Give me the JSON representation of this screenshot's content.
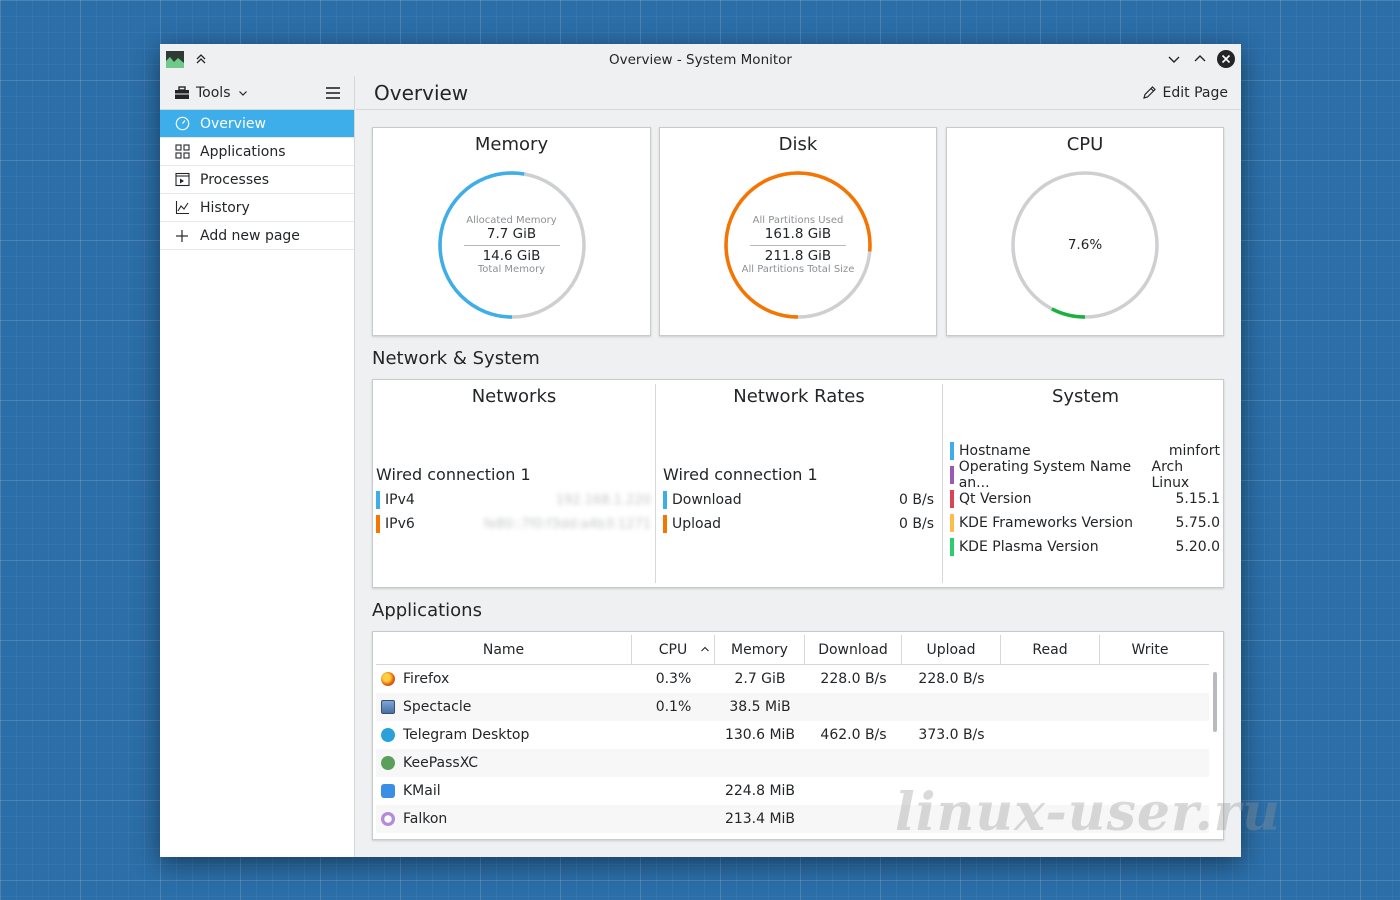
{
  "window": {
    "title": "Overview - System Monitor"
  },
  "sidebar": {
    "tools_label": "Tools",
    "items": [
      {
        "label": "Overview",
        "icon": "speedometer-icon",
        "active": true
      },
      {
        "label": "Applications",
        "icon": "grid-icon"
      },
      {
        "label": "Processes",
        "icon": "terminal-window-icon"
      },
      {
        "label": "History",
        "icon": "line-chart-icon"
      },
      {
        "label": "Add new page",
        "icon": "plus-icon"
      }
    ]
  },
  "header": {
    "title": "Overview",
    "edit_label": "Edit Page"
  },
  "gauges": {
    "memory": {
      "title": "Memory",
      "top_label": "Allocated Memory",
      "used": "7.7 GiB",
      "total": "14.6 GiB",
      "bottom_label": "Total Memory",
      "fraction": 0.527,
      "color": "#3daee9"
    },
    "disk": {
      "title": "Disk",
      "top_label": "All Partitions Used",
      "used": "161.8 GiB",
      "total": "211.8 GiB",
      "bottom_label": "All Partitions Total Size",
      "fraction": 0.764,
      "color": "#f67400"
    },
    "cpu": {
      "title": "CPU",
      "value": "7.6%",
      "fraction": 0.076,
      "color": "#1cb13c"
    }
  },
  "network_section": {
    "title": "Network & System",
    "networks": {
      "title": "Networks",
      "connection": "Wired connection 1",
      "rows": [
        {
          "label": "IPv4",
          "value": "192.168.1.220",
          "color": "#3daee9"
        },
        {
          "label": "IPv6",
          "value": "fe80::7f0:f3dd:a4b3:1271",
          "color": "#f67400"
        }
      ]
    },
    "rates": {
      "title": "Network Rates",
      "connection": "Wired connection 1",
      "rows": [
        {
          "label": "Download",
          "value": "0 B/s",
          "color": "#3daee9"
        },
        {
          "label": "Upload",
          "value": "0 B/s",
          "color": "#f67400"
        }
      ]
    },
    "system": {
      "title": "System",
      "rows": [
        {
          "label": "Hostname",
          "value": "minfort",
          "color": "#3daee9"
        },
        {
          "label": "Operating System Name an...",
          "value": "Arch Linux",
          "color": "#9b59b6"
        },
        {
          "label": "Qt Version",
          "value": "5.15.1",
          "color": "#da4453"
        },
        {
          "label": "KDE Frameworks Version",
          "value": "5.75.0",
          "color": "#fdbc4b"
        },
        {
          "label": "KDE Plasma Version",
          "value": "5.20.0",
          "color": "#2ecc71"
        }
      ]
    }
  },
  "applications": {
    "title": "Applications",
    "columns": [
      "Name",
      "CPU",
      "Memory",
      "Download",
      "Upload",
      "Read",
      "Write"
    ],
    "rows": [
      {
        "name": "Firefox",
        "icon": "firefox-icon",
        "icon_color": "#e66000",
        "cpu": "0.3%",
        "memory": "2.7 GiB",
        "download": "228.0 B/s",
        "upload": "228.0 B/s"
      },
      {
        "name": "Spectacle",
        "icon": "spectacle-icon",
        "icon_color": "#4a6fa5",
        "cpu": "0.1%",
        "memory": "38.5 MiB",
        "download": "",
        "upload": ""
      },
      {
        "name": "Telegram Desktop",
        "icon": "telegram-icon",
        "icon_color": "#2aa1da",
        "cpu": "",
        "memory": "130.6 MiB",
        "download": "462.0 B/s",
        "upload": "373.0 B/s"
      },
      {
        "name": "KeePassXC",
        "icon": "keepassxc-icon",
        "icon_color": "#5aa05a",
        "cpu": "",
        "memory": "",
        "download": "",
        "upload": ""
      },
      {
        "name": "KMail",
        "icon": "kmail-icon",
        "icon_color": "#3a8ee6",
        "cpu": "",
        "memory": "224.8 MiB",
        "download": "",
        "upload": ""
      },
      {
        "name": "Falkon",
        "icon": "falkon-icon",
        "icon_color": "#b58ad8",
        "cpu": "",
        "memory": "213.4 MiB",
        "download": "",
        "upload": ""
      }
    ]
  },
  "watermark": "linux-user.ru"
}
